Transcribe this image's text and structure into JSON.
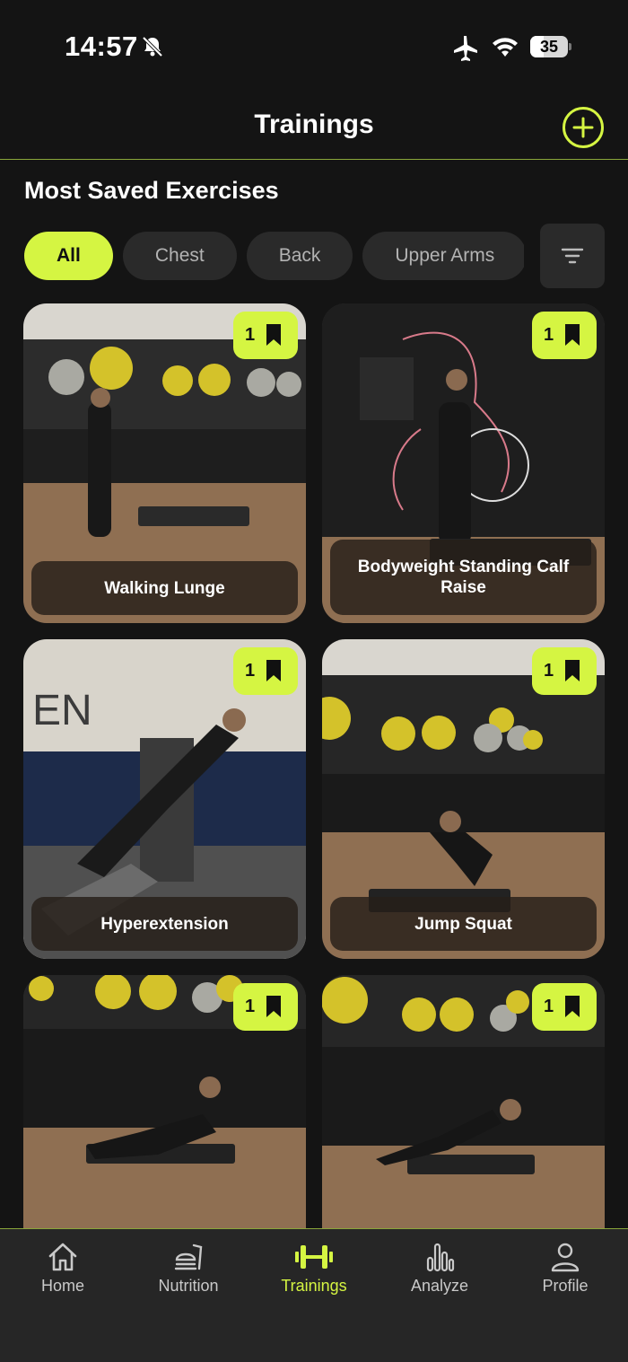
{
  "status_bar": {
    "time": "14:57",
    "battery_level": "35",
    "icons": [
      "bell-slash-icon",
      "airplane-icon",
      "wifi-icon",
      "battery-icon"
    ]
  },
  "header": {
    "title": "Trainings",
    "add_icon": "plus-circle-icon"
  },
  "section": {
    "title": "Most Saved Exercises"
  },
  "filters": {
    "chips": [
      "All",
      "Chest",
      "Back",
      "Upper Arms"
    ],
    "active": "All",
    "filter_icon": "filter-lines-icon"
  },
  "exercises": [
    {
      "name": "Walking Lunge",
      "saves": "1"
    },
    {
      "name": "Bodyweight Standing Calf Raise",
      "saves": "1"
    },
    {
      "name": "Hyperextension",
      "saves": "1"
    },
    {
      "name": "Jump Squat",
      "saves": "1"
    },
    {
      "name": "",
      "saves": "1"
    },
    {
      "name": "",
      "saves": "1"
    }
  ],
  "tab_bar": {
    "tabs": [
      {
        "label": "Home",
        "icon": "home-icon"
      },
      {
        "label": "Nutrition",
        "icon": "nutrition-icon"
      },
      {
        "label": "Trainings",
        "icon": "dumbbell-icon"
      },
      {
        "label": "Analyze",
        "icon": "bar-chart-icon"
      },
      {
        "label": "Profile",
        "icon": "user-icon"
      }
    ],
    "active": "Trainings"
  },
  "colors": {
    "accent": "#d5f542",
    "background": "#141414",
    "chip": "#2a2a2a",
    "tab_bar": "#262626"
  }
}
